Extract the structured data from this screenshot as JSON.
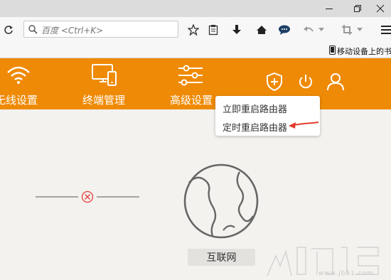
{
  "browser": {
    "search_placeholder": "百度 <Ctrl+K>",
    "bookmark_text": "移动设备上的书"
  },
  "nav": {
    "items": [
      {
        "label": "无线设置"
      },
      {
        "label": "终端管理"
      },
      {
        "label": "高级设置"
      }
    ]
  },
  "dropdown": {
    "items": [
      {
        "label": "立即重启路由器"
      },
      {
        "label": "定时重启路由器"
      }
    ]
  },
  "network": {
    "internet_label": "互联网"
  },
  "watermark": {
    "domain": "www.jb51.com"
  },
  "colors": {
    "brand_orange": "#ef8a06",
    "error_red": "#e63b3b",
    "arrow_red": "#e23b2b"
  }
}
